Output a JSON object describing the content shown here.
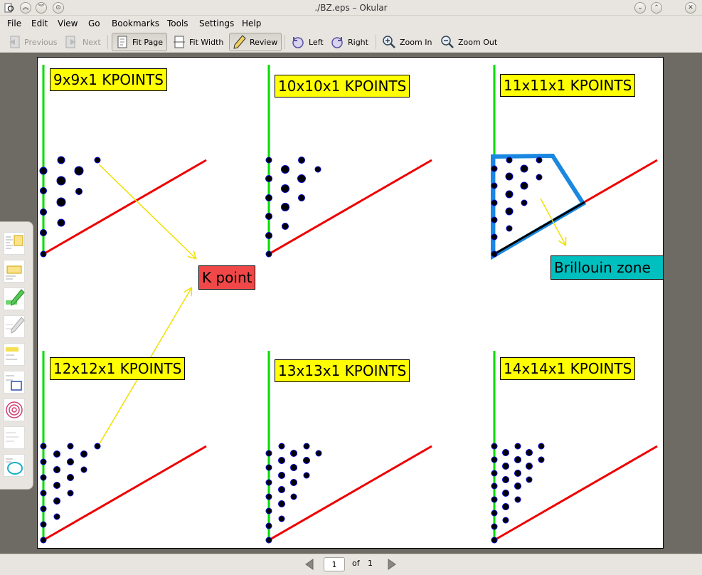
{
  "window": {
    "title": "./BZ.eps – Okular"
  },
  "menu": [
    "File",
    "Edit",
    "View",
    "Go",
    "Bookmarks",
    "Tools",
    "Settings",
    "Help"
  ],
  "toolbar": {
    "previous": "Previous",
    "next": "Next",
    "fit_page": "Fit Page",
    "fit_width": "Fit Width",
    "review": "Review",
    "left": "Left",
    "right": "Right",
    "zoom_in": "Zoom In",
    "zoom_out": "Zoom Out"
  },
  "document": {
    "labels": [
      "9x9x1 KPOINTS",
      "10x10x1 KPOINTS",
      "11x11x1 KPOINTS",
      "12x12x1 KPOINTS",
      "13x13x1 KPOINTS",
      "14x14x1 KPOINTS"
    ],
    "kpoint_label": "K point",
    "bz_label": "Brillouin zone"
  },
  "navigation": {
    "page_value": "1",
    "of_label": "of",
    "total_pages": "1"
  },
  "colors": {
    "axis_green": "#00dd00",
    "line_red": "#ee0000",
    "bz_blue": "#1a88e0",
    "arrow_yellow": "#f0e000",
    "dot_fill": "#000000",
    "dot_stroke": "#0000cc"
  }
}
